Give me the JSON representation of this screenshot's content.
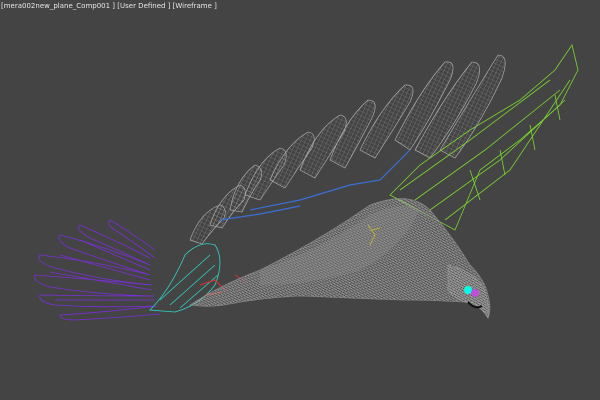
{
  "viewport": {
    "camera_label": "[mera002new_plane_Comp001 ]",
    "shading_label": "[User Defined ]",
    "mode_label": "[Wireframe ]"
  },
  "scene": {
    "subject": "bird-wireframe-model",
    "colors": {
      "background": "#444444",
      "wire_gray": "#b8b8b8",
      "wire_dense": "#8c8c8c",
      "wire_purple": "#7a2fd6",
      "wire_teal": "#2fd6c8",
      "wire_green": "#7ad62f",
      "wire_blue": "#3a6fd6",
      "wire_red": "#d6342f",
      "wire_olive": "#b8b03a",
      "eye_cyan": "#00ffe6",
      "eye_magenta": "#c24ddb"
    }
  }
}
